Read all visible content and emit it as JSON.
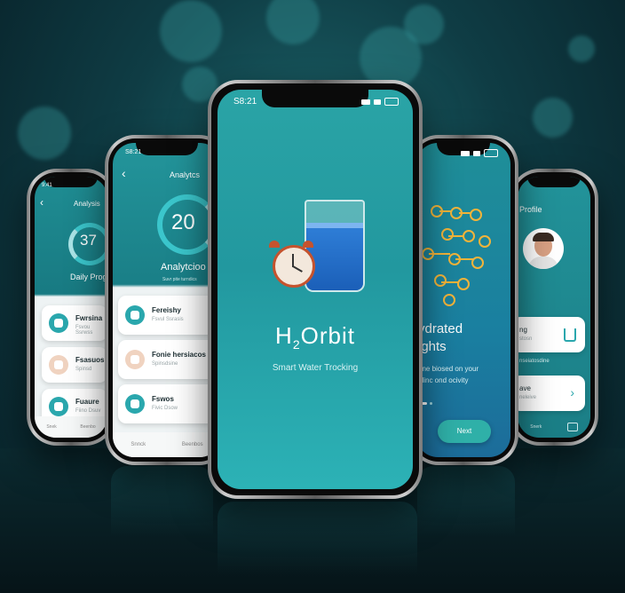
{
  "brand": {
    "logo_main_a": "H",
    "logo_sub": "2",
    "logo_main_b": "Orbit",
    "tagline": "Smart Water Trocking"
  },
  "status_time_center": "S8:21",
  "status_time_left": "S8:21",
  "status_time_far_left": "9:41",
  "analytics_phone": {
    "title": "Analytcs",
    "ring_value": "20",
    "heading": "Analytcioo",
    "subheading": "Suvr pite turndics",
    "cards": [
      {
        "title": "Fereishy",
        "subtitle": "Fsvul Ssrasis"
      },
      {
        "title": "Fonie hersiacos",
        "subtitle": "Spinsdsine"
      },
      {
        "title": "Fswos",
        "subtitle": "Fivic Dsow"
      }
    ],
    "tabbar": [
      "Snnck",
      "Beenbos"
    ]
  },
  "far_left_phone": {
    "title": "Analysis",
    "ring_value": "37",
    "heading": "Daily Prog",
    "cards": [
      {
        "title": "Fwrsina",
        "subtitle": "Fsvou Ssrwss"
      },
      {
        "title": "Fsasuos",
        "subtitle": "Spinsd"
      },
      {
        "title": "Fuaure",
        "subtitle": "Fiino Dsuv"
      }
    ],
    "tabbar": [
      "Snek",
      "Beenbo"
    ]
  },
  "onboarding_phone": {
    "heading_line1": "ydrated",
    "heading_line2": "ights",
    "body_line1": "ene biosed on your",
    "body_line2": "ulinc ond ocivity",
    "next_button": "Next"
  },
  "profile_phone": {
    "title": "Profile",
    "card1_label": "ng",
    "card1_sub": "stosn",
    "section_label": "nseiatosdine",
    "card2_label": "ave",
    "card2_sub": "neleive",
    "tabbar": [
      "Snerk"
    ]
  },
  "colors": {
    "teal": "#2aa7ad",
    "teal_dark": "#177c84",
    "accent_orange": "#f2b43a",
    "background": "#0f3d45"
  },
  "icons": [
    "signal-icon",
    "wifi-icon",
    "battery-icon",
    "back-icon",
    "alarm-clock-icon",
    "water-glass-icon",
    "chevron-right-icon",
    "home-icon",
    "avatar"
  ]
}
